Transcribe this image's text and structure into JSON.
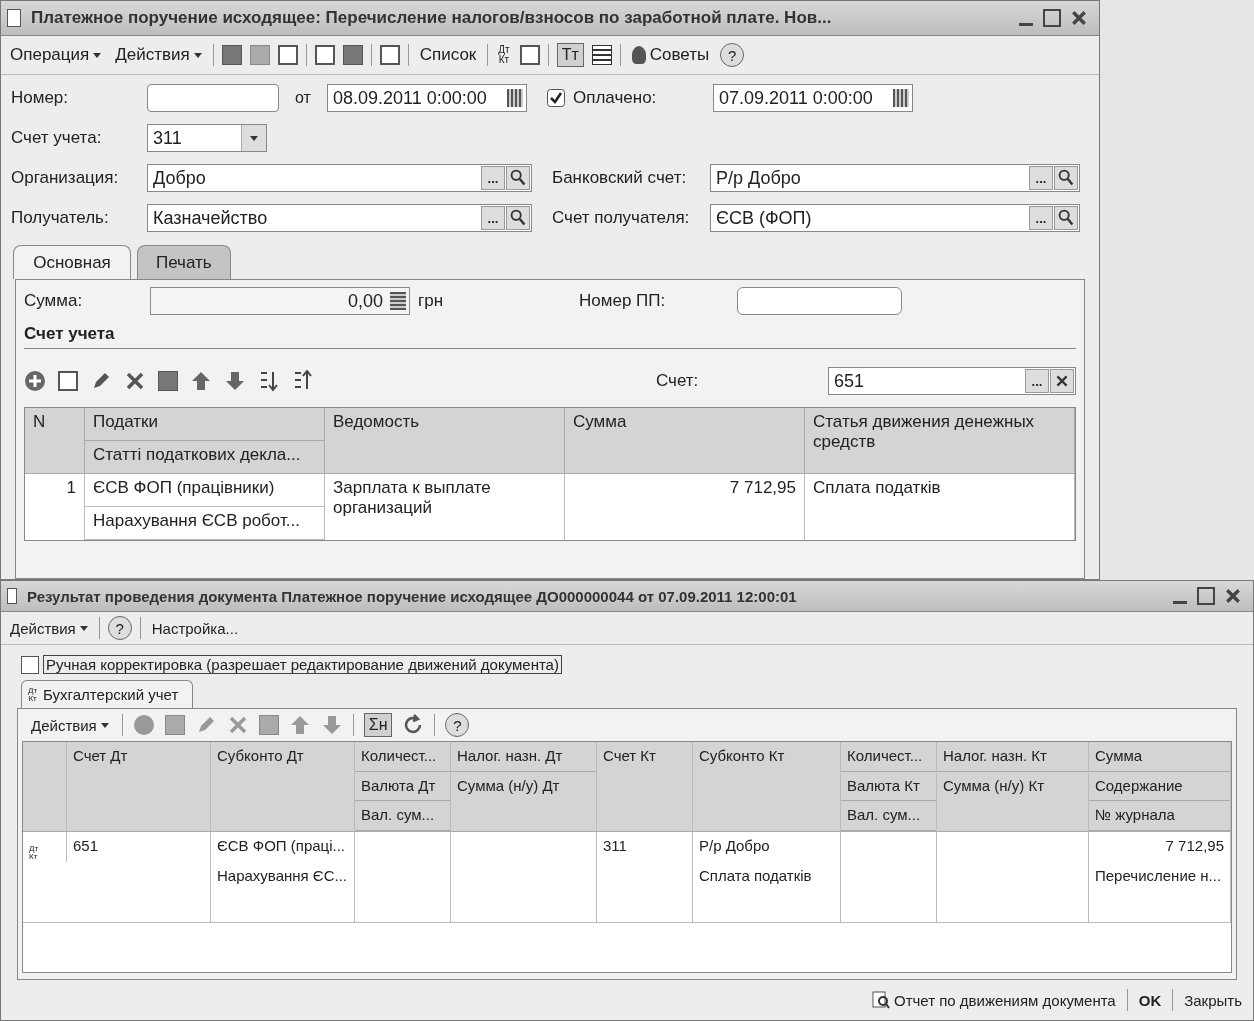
{
  "payment_window": {
    "title": "Платежное поручение исходящее: Перечисление налогов/взносов по заработной плате. Нов...",
    "toolbar": {
      "menus": [
        "Операция",
        "Действия"
      ],
      "list_button": "Список",
      "dt_kt": [
        "Дт",
        "Кт"
      ],
      "text_toggle": "Тт",
      "text_toggle_pressed": true,
      "tips_button": "Советы",
      "help_button": "?"
    },
    "number": {
      "label": "Номер:"
    },
    "date_prefix": "от",
    "date": "08.09.2011 0:00:00",
    "paid": {
      "label": "Оплачено:",
      "checked": true,
      "date": "07.09.2011 0:00:00"
    },
    "account": {
      "label": "Счет учета:",
      "value": "311"
    },
    "organization": {
      "label": "Организация:",
      "value": "Добро",
      "select_button": "..."
    },
    "bank_account": {
      "label": "Банковский счет:",
      "value": "Р/р Добро",
      "select_button": "..."
    },
    "recipient": {
      "label": "Получатель:",
      "value": "Казначейство",
      "select_button": "..."
    },
    "recipient_account": {
      "label": "Счет получателя:",
      "value": "ЄСВ (ФОП)",
      "select_button": "..."
    },
    "tabs": [
      {
        "label": "Основная",
        "selected": true
      },
      {
        "label": "Печать",
        "selected": false
      }
    ],
    "amount": {
      "label": "Сумма:",
      "value": "0,00",
      "currency": "грн"
    },
    "pp_number": {
      "label": "Номер ПП:"
    },
    "section_title": "Счет учета",
    "account_filter": {
      "label": "Счет:",
      "value": "651",
      "select_button": "..."
    },
    "table": {
      "columns": [
        {
          "header": [
            "N"
          ]
        },
        {
          "header": [
            "Податки",
            "Статті податкових декла..."
          ]
        },
        {
          "header": [
            "Ведомость"
          ]
        },
        {
          "header": [
            "Сумма"
          ]
        },
        {
          "header": [
            "Статья движения денежных средств"
          ]
        }
      ],
      "rows": [
        {
          "n": "1",
          "tax": [
            "ЄСВ ФОП (працівники)",
            "Нарахування ЄСВ робот..."
          ],
          "statement": "Зарплата к выплате организаций",
          "amount": "7 712,95",
          "cash_flow_item": "Сплата податків"
        }
      ]
    }
  },
  "result_window": {
    "title": "Результат проведения документа Платежное поручение исходящее ДО000000044 от 07.09.2011 12:00:01",
    "toolbar": {
      "menu": "Действия",
      "help_button": "?",
      "settings": "Настройка..."
    },
    "manual_edit": {
      "label": "Ручная корректировка (разрешает редактирование движений документа)",
      "checked": false
    },
    "tabs": [
      {
        "label": "Бухгалтерский учет",
        "icon_text": [
          "Дт",
          "Кт"
        ],
        "selected": true
      }
    ],
    "grid_toolbar": {
      "menu": "Действия",
      "sum_toggle": "Σн",
      "sum_toggle_pressed": true,
      "help_button": "?"
    },
    "grid": {
      "columns": [
        {
          "header": [
            "Счет Дт"
          ]
        },
        {
          "header": [
            "Субконто Дт"
          ]
        },
        {
          "header": [
            "Количест...",
            "Валюта Дт",
            "Вал. сум..."
          ]
        },
        {
          "header": [
            "Налог. назн. Дт",
            "Сумма (н/у) Дт"
          ]
        },
        {
          "header": [
            "Счет Кт"
          ]
        },
        {
          "header": [
            "Субконто Кт"
          ]
        },
        {
          "header": [
            "Количест...",
            "Валюта Кт",
            "Вал. сум..."
          ]
        },
        {
          "header": [
            "Налог. назн. Кт",
            "Сумма (н/у) Кт"
          ]
        },
        {
          "header": [
            "Сумма",
            "Содержание",
            "№ журнала"
          ]
        }
      ],
      "rows": [
        {
          "icon_text": [
            "Дт",
            "Кт"
          ],
          "cells": [
            [
              "651"
            ],
            [
              "ЄСВ ФОП (праці...",
              "Нарахування ЄС..."
            ],
            [],
            [],
            [
              "311"
            ],
            [
              "Р/р Добро",
              "Сплата податків"
            ],
            [],
            [],
            [
              "7 712,95",
              "Перечисление н..."
            ]
          ]
        }
      ]
    },
    "status_bar": {
      "report_link": "Отчет по движениям документа",
      "ok_button": "OK",
      "close_button": "Закрыть"
    }
  }
}
